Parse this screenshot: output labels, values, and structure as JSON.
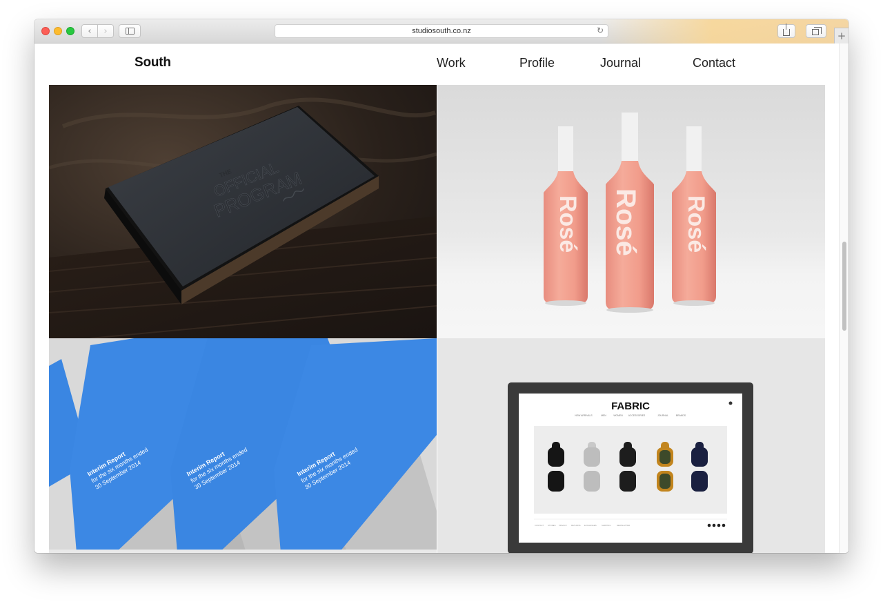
{
  "browser": {
    "url": "studiosouth.co.nz",
    "back_icon": "chevron-left-icon",
    "forward_icon": "chevron-right-icon",
    "sidebar_icon": "sidebar-icon",
    "reload_icon": "reload-icon",
    "share_icon": "share-icon",
    "tabs_icon": "tabs-icon",
    "newtab_icon": "plus-icon"
  },
  "site": {
    "logo": "South",
    "nav": [
      "Work",
      "Profile",
      "Journal",
      "Contact"
    ]
  },
  "tiles": {
    "program": {
      "line1": "OFFICIAL",
      "line2": "PROGRAM",
      "small": "THE"
    },
    "rose": {
      "bottle_label": "Rosé",
      "bottle_count": 3,
      "colors": {
        "wine": "#f3a292",
        "label": "#fbe9e4",
        "cap": "#f2f2f2"
      }
    },
    "interim": {
      "line1": "Interim Report",
      "line2": "for the six months ended",
      "line3": "30 September 2014",
      "color": "#3a86e2"
    },
    "fabric": {
      "brand": "FABRIC",
      "menu": [
        "NEW ARRIVALS",
        "MEN",
        "WOMEN",
        "ACCESSORIES",
        "JOURNAL",
        "BRANDS"
      ],
      "footer_links": [
        "CONTACT",
        "STORES",
        "PRIVACY",
        "RETURNS",
        "EXCHANGES",
        "SHIPPING",
        "NEWSLETTER"
      ],
      "sunglasses_colors": [
        "#151515",
        "#c9c9c9",
        "#1d1d1d",
        "#c2851e",
        "#1a2040"
      ]
    }
  }
}
